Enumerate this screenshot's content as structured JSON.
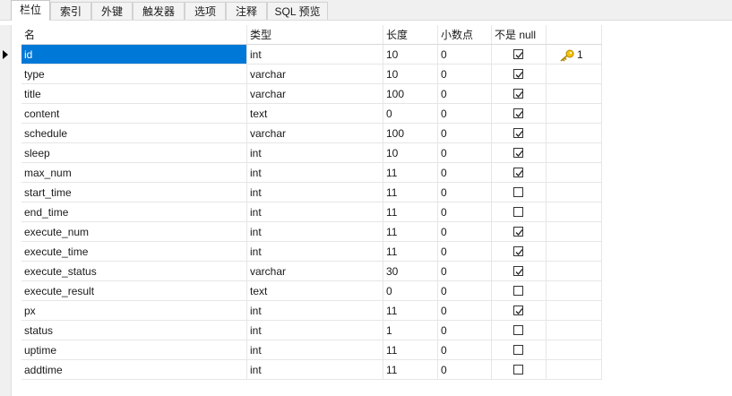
{
  "tabs": [
    {
      "label": "栏位",
      "active": true
    },
    {
      "label": "索引",
      "active": false
    },
    {
      "label": "外键",
      "active": false
    },
    {
      "label": "触发器",
      "active": false
    },
    {
      "label": "选项",
      "active": false
    },
    {
      "label": "注释",
      "active": false
    },
    {
      "label": "SQL 预览",
      "active": false
    }
  ],
  "columns_header": {
    "name": "名",
    "type": "类型",
    "length": "长度",
    "decimals": "小数点",
    "not_null": "不是 null",
    "key": ""
  },
  "fields": [
    {
      "name": "id",
      "type": "int",
      "length": "10",
      "decimals": "0",
      "not_null": true,
      "key": "1",
      "selected": true
    },
    {
      "name": "type",
      "type": "varchar",
      "length": "10",
      "decimals": "0",
      "not_null": true,
      "key": ""
    },
    {
      "name": "title",
      "type": "varchar",
      "length": "100",
      "decimals": "0",
      "not_null": true,
      "key": ""
    },
    {
      "name": "content",
      "type": "text",
      "length": "0",
      "decimals": "0",
      "not_null": true,
      "key": ""
    },
    {
      "name": "schedule",
      "type": "varchar",
      "length": "100",
      "decimals": "0",
      "not_null": true,
      "key": ""
    },
    {
      "name": "sleep",
      "type": "int",
      "length": "10",
      "decimals": "0",
      "not_null": true,
      "key": ""
    },
    {
      "name": "max_num",
      "type": "int",
      "length": "11",
      "decimals": "0",
      "not_null": true,
      "key": ""
    },
    {
      "name": "start_time",
      "type": "int",
      "length": "11",
      "decimals": "0",
      "not_null": false,
      "key": ""
    },
    {
      "name": "end_time",
      "type": "int",
      "length": "11",
      "decimals": "0",
      "not_null": false,
      "key": ""
    },
    {
      "name": "execute_num",
      "type": "int",
      "length": "11",
      "decimals": "0",
      "not_null": true,
      "key": ""
    },
    {
      "name": "execute_time",
      "type": "int",
      "length": "11",
      "decimals": "0",
      "not_null": true,
      "key": ""
    },
    {
      "name": "execute_status",
      "type": "varchar",
      "length": "30",
      "decimals": "0",
      "not_null": true,
      "key": ""
    },
    {
      "name": "execute_result",
      "type": "text",
      "length": "0",
      "decimals": "0",
      "not_null": false,
      "key": ""
    },
    {
      "name": "px",
      "type": "int",
      "length": "11",
      "decimals": "0",
      "not_null": true,
      "key": ""
    },
    {
      "name": "status",
      "type": "int",
      "length": "1",
      "decimals": "0",
      "not_null": false,
      "key": ""
    },
    {
      "name": "uptime",
      "type": "int",
      "length": "11",
      "decimals": "0",
      "not_null": false,
      "key": ""
    },
    {
      "name": "addtime",
      "type": "int",
      "length": "11",
      "decimals": "0",
      "not_null": false,
      "key": ""
    }
  ],
  "icons": {
    "primary_key": "key-icon",
    "current_row": "row-pointer-icon",
    "checked": "checkbox-checked-icon"
  },
  "colors": {
    "selection": "#0078d7",
    "key_gold": "#e8a800"
  }
}
